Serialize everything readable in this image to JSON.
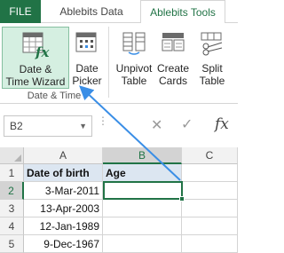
{
  "ribbon": {
    "tabs": {
      "file": "FILE",
      "data": "Ablebits Data",
      "tools": "Ablebits Tools"
    },
    "buttons": {
      "wizard": "Date &\nTime Wizard",
      "picker": "Date\nPicker",
      "unpivot": "Unpivot\nTable",
      "cards": "Create\nCards",
      "split": "Split\nTable"
    },
    "group_label": "Date & Time"
  },
  "formula_bar": {
    "name_box": "B2",
    "fx_label": "fx"
  },
  "grid": {
    "columns": [
      "A",
      "B",
      "C"
    ],
    "rows": [
      {
        "num": "1",
        "a": "Date of birth",
        "b": "Age",
        "c": ""
      },
      {
        "num": "2",
        "a": "3-Mar-2011",
        "b": "",
        "c": ""
      },
      {
        "num": "3",
        "a": "13-Apr-2003",
        "b": "",
        "c": ""
      },
      {
        "num": "4",
        "a": "12-Jan-1989",
        "b": "",
        "c": ""
      },
      {
        "num": "5",
        "a": "9-Dec-1967",
        "b": "",
        "c": ""
      }
    ],
    "active_cell": "B2"
  },
  "colors": {
    "excel_green": "#217346",
    "header_fill": "#dce6f1",
    "callout_arrow": "#3a8ee6"
  }
}
